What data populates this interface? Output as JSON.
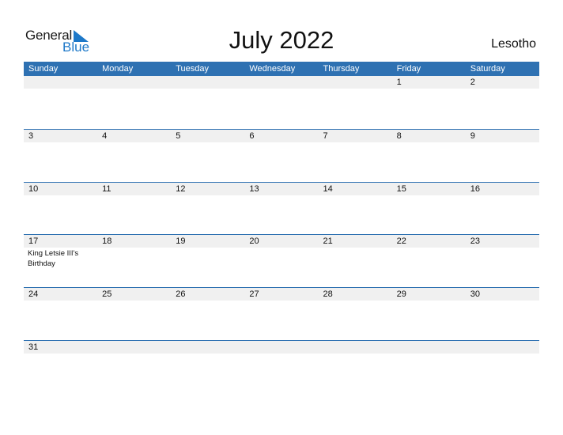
{
  "logo": {
    "line1": "General",
    "line2": "Blue"
  },
  "title": "July 2022",
  "country": "Lesotho",
  "colors": {
    "accent": "#2e71b2",
    "strip": "#f0f0f0",
    "logo_blue": "#1d78c8"
  },
  "weekdays": [
    "Sunday",
    "Monday",
    "Tuesday",
    "Wednesday",
    "Thursday",
    "Friday",
    "Saturday"
  ],
  "weeks": [
    {
      "days": [
        "",
        "",
        "",
        "",
        "",
        "1",
        "2"
      ],
      "events": [
        "",
        "",
        "",
        "",
        "",
        "",
        ""
      ]
    },
    {
      "days": [
        "3",
        "4",
        "5",
        "6",
        "7",
        "8",
        "9"
      ],
      "events": [
        "",
        "",
        "",
        "",
        "",
        "",
        ""
      ]
    },
    {
      "days": [
        "10",
        "11",
        "12",
        "13",
        "14",
        "15",
        "16"
      ],
      "events": [
        "",
        "",
        "",
        "",
        "",
        "",
        ""
      ]
    },
    {
      "days": [
        "17",
        "18",
        "19",
        "20",
        "21",
        "22",
        "23"
      ],
      "events": [
        "King Letsie III's Birthday",
        "",
        "",
        "",
        "",
        "",
        ""
      ]
    },
    {
      "days": [
        "24",
        "25",
        "26",
        "27",
        "28",
        "29",
        "30"
      ],
      "events": [
        "",
        "",
        "",
        "",
        "",
        "",
        ""
      ]
    },
    {
      "days": [
        "31",
        "",
        "",
        "",
        "",
        "",
        ""
      ],
      "events": [
        "",
        "",
        "",
        "",
        "",
        "",
        ""
      ]
    }
  ]
}
